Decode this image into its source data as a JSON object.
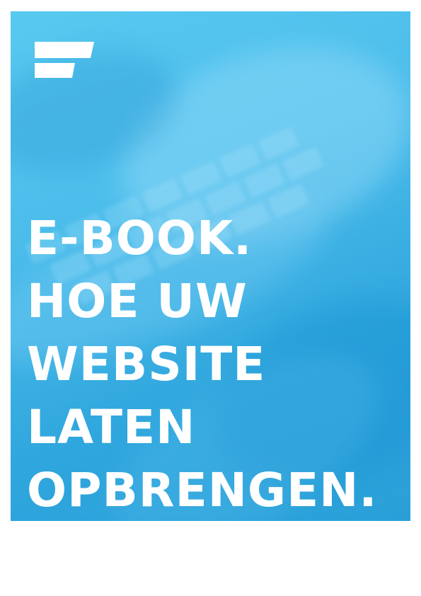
{
  "cover": {
    "background_color": "#4cbdeb",
    "logo_icon": "stacked-bars-logo",
    "title_lines": [
      "E-BOOK.",
      "HOE UW",
      "WEBSITE",
      "LATEN",
      "OPBRENGEN."
    ]
  }
}
